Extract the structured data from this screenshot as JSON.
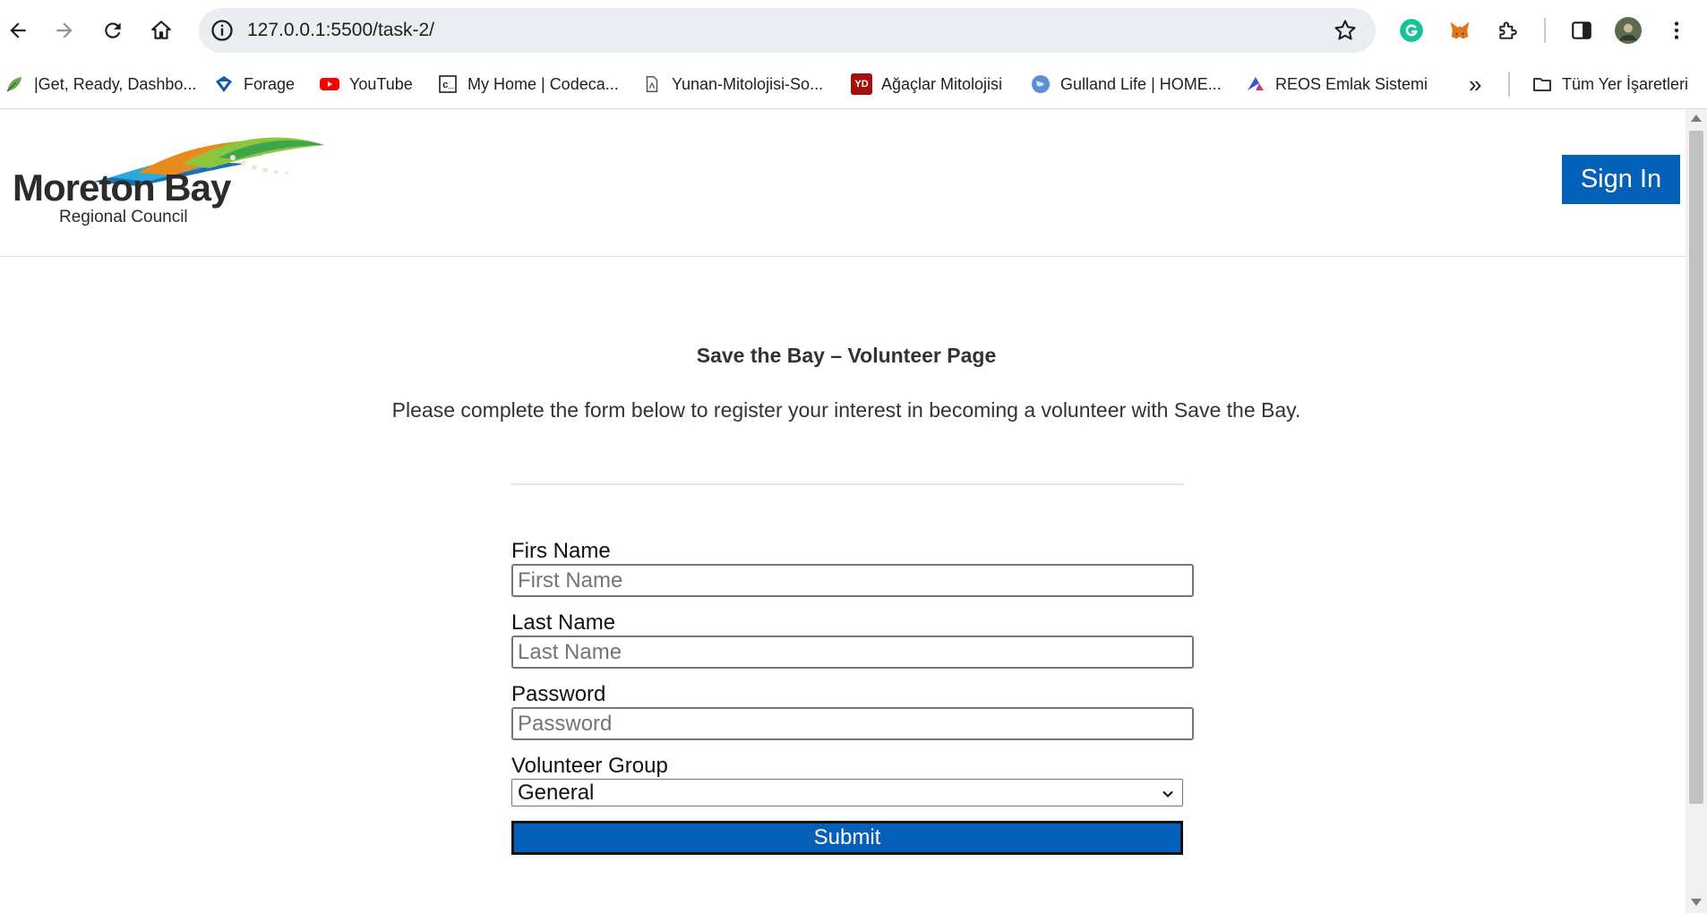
{
  "browser": {
    "url": "127.0.0.1:5500/task-2/",
    "bookmarks": [
      {
        "label": "|Get, Ready, Dashbo...",
        "icon": "leaf-icon"
      },
      {
        "label": "Forage",
        "icon": "forage-icon"
      },
      {
        "label": "YouTube",
        "icon": "youtube-icon"
      },
      {
        "label": "My Home | Codeca...",
        "icon": "codecademy-icon"
      },
      {
        "label": "Yunan-Mitolojisi-So...",
        "icon": "document-icon"
      },
      {
        "label": "Ağaçlar Mitolojisi",
        "icon": "yd-icon",
        "icon_text": "YD"
      },
      {
        "label": "Gulland Life | HOME...",
        "icon": "globe-icon"
      },
      {
        "label": "REOS Emlak Sistemi",
        "icon": "reos-icon"
      }
    ],
    "more_label": "»",
    "all_bookmarks_label": "Tüm Yer İşaretleri"
  },
  "site": {
    "logo": {
      "line1": "Moreton Bay",
      "line2": "Regional Council"
    },
    "signin_label": "Sign In"
  },
  "main": {
    "title": "Save the Bay – Volunteer Page",
    "intro": "Please complete the form below to register your interest in becoming a volunteer with Save the Bay."
  },
  "form": {
    "first_name": {
      "label": "Firs Name",
      "placeholder": "First Name",
      "value": ""
    },
    "last_name": {
      "label": "Last Name",
      "placeholder": "Last Name",
      "value": ""
    },
    "password": {
      "label": "Password",
      "placeholder": "Password",
      "value": ""
    },
    "group": {
      "label": "Volunteer Group",
      "selected": "General"
    },
    "submit_label": "Submit"
  },
  "colors": {
    "accent": "#0561b7",
    "text": "#333333"
  }
}
